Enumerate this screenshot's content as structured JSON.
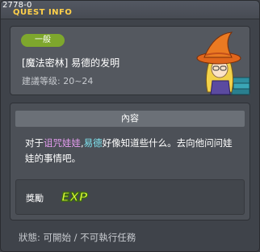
{
  "window": {
    "id": "2778-0",
    "title": "QUEST INFO"
  },
  "quest": {
    "category": "一般",
    "name": "[魔法密林] 易德的发明",
    "level_range": "建議等级: 20~24",
    "npc_icon": "witch-npc-portrait"
  },
  "content": {
    "header": "內容",
    "text_before": "对于",
    "highlight_item": "诅咒娃娃",
    "text_mid": ",",
    "highlight_npc": "易德",
    "text_after": "好像知道些什么。去向他问问娃娃的事情吧。",
    "colors": {
      "item": "#e59cf0",
      "npc": "#7fe4f0"
    }
  },
  "reward": {
    "label": "獎勵",
    "icon": "exp-icon",
    "icon_text": "EXP"
  },
  "status": {
    "text": "狀態:  可開始 / 不可執行任務"
  },
  "colors": {
    "title": "#ffd04a",
    "badge": "#7ea72d"
  }
}
